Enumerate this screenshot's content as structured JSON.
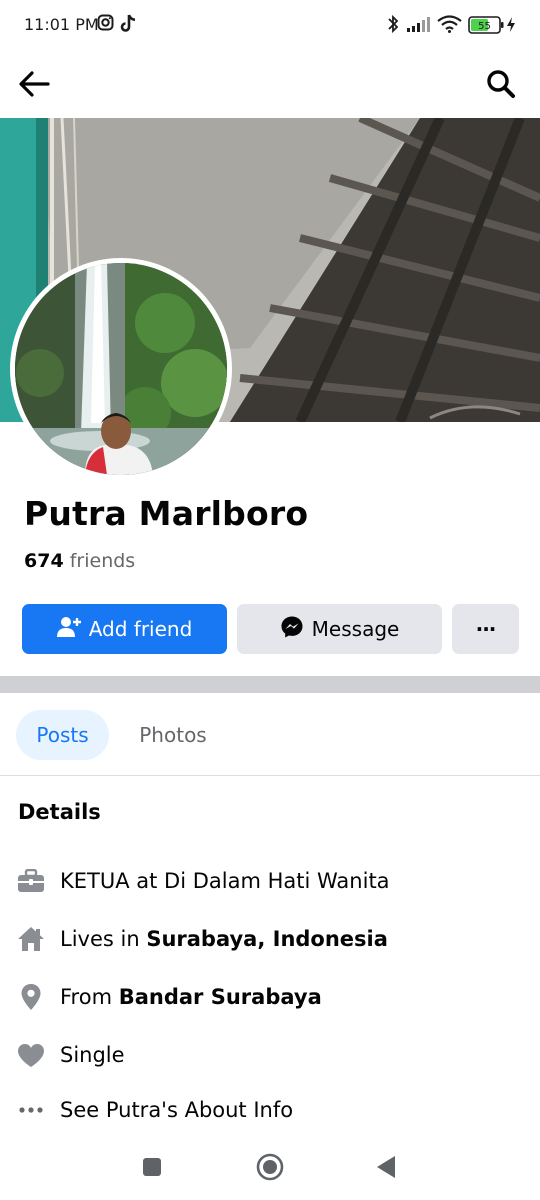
{
  "status_bar": {
    "time": "11:01 PM",
    "battery_level": "55",
    "icons": [
      "instagram-icon",
      "tiktok-icon",
      "bluetooth-icon",
      "signal-icon",
      "wifi-icon",
      "battery-icon",
      "charging-icon"
    ]
  },
  "header": {
    "icons": [
      "back-arrow-icon",
      "search-icon"
    ]
  },
  "profile": {
    "name": "Putra Marlboro",
    "friends_count": "674",
    "friends_label": "friends"
  },
  "actions": {
    "add_friend": "Add friend",
    "message": "Message",
    "more": "···"
  },
  "tabs": [
    {
      "label": "Posts",
      "active": true
    },
    {
      "label": "Photos",
      "active": false
    }
  ],
  "details": {
    "heading": "Details",
    "items": [
      {
        "icon": "briefcase-icon",
        "text": "KETUA at Di Dalam Hati Wanita"
      },
      {
        "icon": "home-icon",
        "prefix": "Lives in ",
        "bold": "Surabaya, Indonesia"
      },
      {
        "icon": "location-pin-icon",
        "prefix": "From ",
        "bold": "Bandar Surabaya"
      },
      {
        "icon": "heart-icon",
        "text": "Single"
      },
      {
        "icon": "more-dots-icon",
        "text": "See Putra's About Info"
      }
    ]
  },
  "colors": {
    "primary": "#1877f2",
    "secondary_button": "#e4e6eb",
    "active_tab_bg": "#e7f3ff",
    "muted_text": "#65676b",
    "icon_gray": "#8a8d91"
  },
  "nav_bar": {
    "icons": [
      "recent-apps-icon",
      "home-button-icon",
      "back-nav-icon"
    ]
  }
}
